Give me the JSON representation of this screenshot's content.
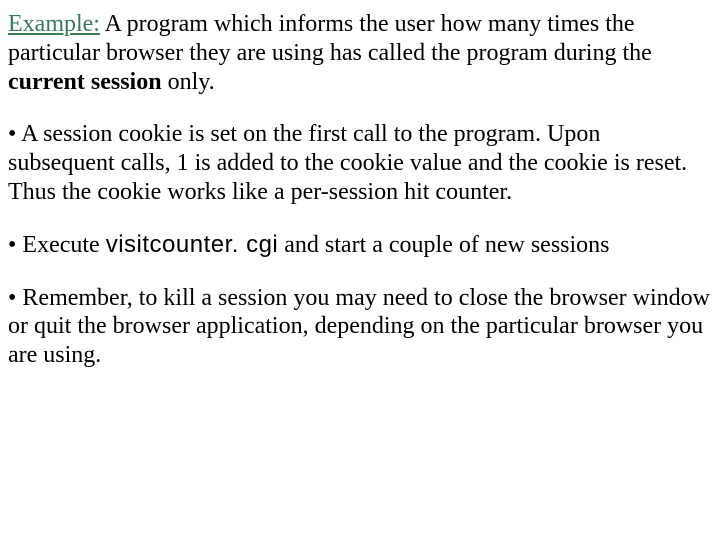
{
  "example": {
    "label": "Example:",
    "text_part1": " A program which informs the user how many times the particular browser they are using has called the program during the ",
    "bold_phrase": "current session",
    "text_part2": " only."
  },
  "bullet1": "• A session cookie is set on the first call to the program.  Upon subsequent calls, 1 is added to the cookie value and the cookie is reset.  Thus the cookie works like a per-session hit counter.",
  "bullet2": {
    "prefix": "• Execute ",
    "code": "visitcounter. cgi",
    "suffix": " and start a couple of new sessions"
  },
  "bullet3": "• Remember, to kill a session you may need to close the browser window or quit the browser application, depending on the particular browser you are using."
}
